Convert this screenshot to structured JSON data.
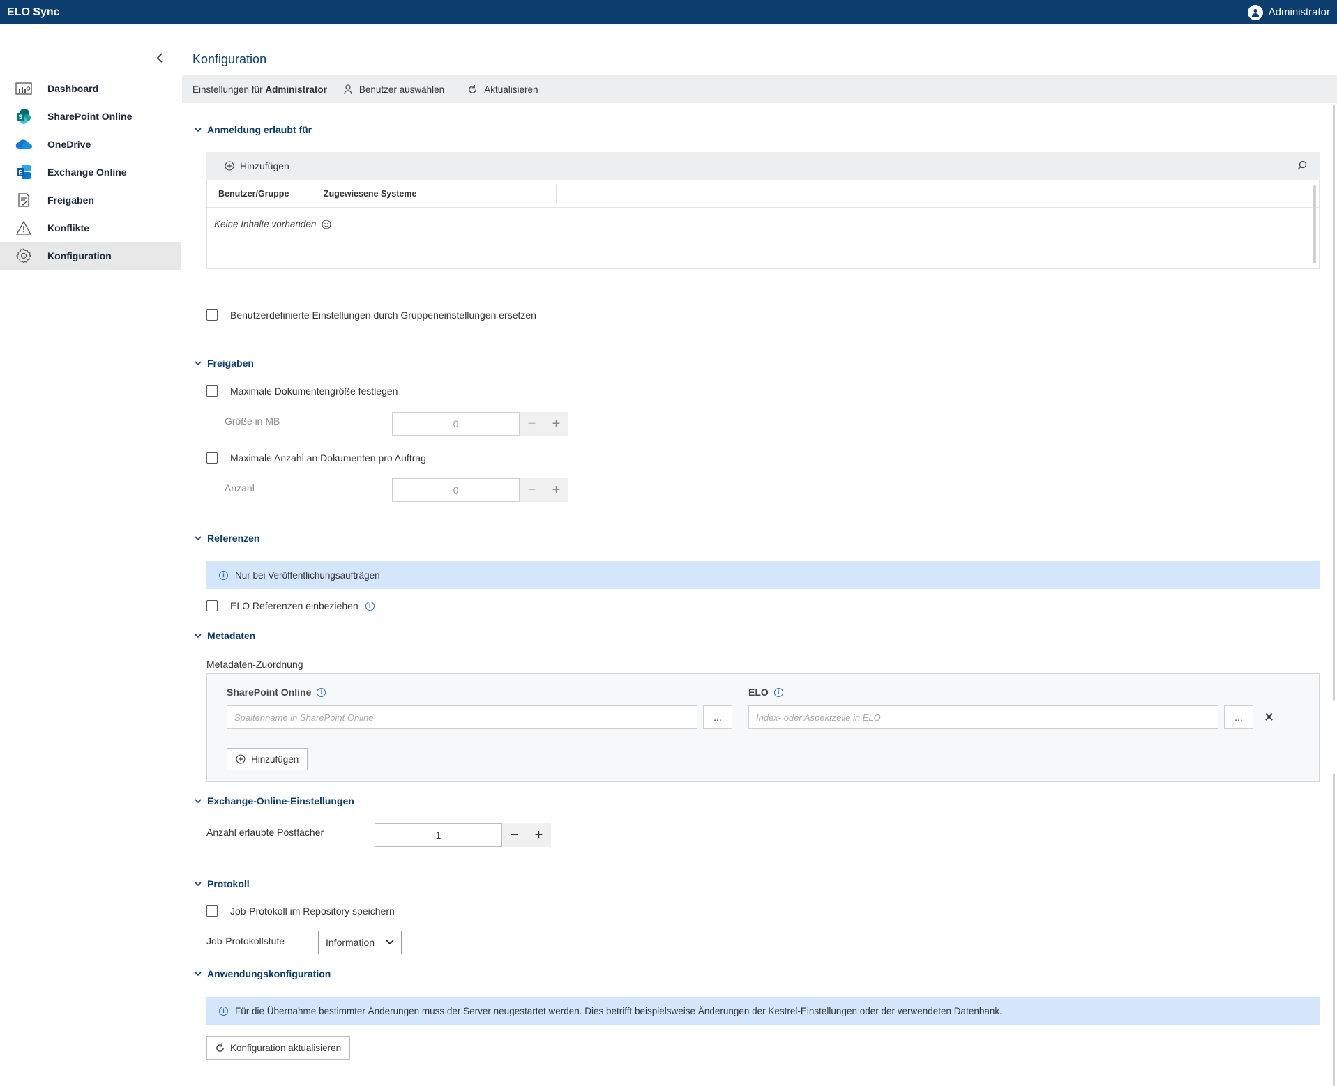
{
  "app": {
    "title": "ELO Sync",
    "user": "Administrator"
  },
  "sidebar": {
    "items": [
      {
        "label": "Dashboard",
        "icon": "dashboard-icon"
      },
      {
        "label": "SharePoint Online",
        "icon": "sharepoint-icon"
      },
      {
        "label": "OneDrive",
        "icon": "onedrive-icon"
      },
      {
        "label": "Exchange Online",
        "icon": "exchange-icon"
      },
      {
        "label": "Freigaben",
        "icon": "approval-icon"
      },
      {
        "label": "Konflikte",
        "icon": "warning-icon"
      },
      {
        "label": "Konfiguration",
        "icon": "gear-icon",
        "active": true
      }
    ]
  },
  "page": {
    "title": "Konfiguration"
  },
  "toolbar": {
    "settings_prefix": "Einstellungen für",
    "settings_user": "Administrator",
    "select_user": "Benutzer auswählen",
    "refresh": "Aktualisieren"
  },
  "login": {
    "heading": "Anmeldung erlaubt für",
    "add": "Hinzufügen",
    "columns": [
      "Benutzer/Gruppe",
      "Zugewiesene Systeme"
    ],
    "empty": "Keine Inhalte vorhanden",
    "replace_checkbox": "Benutzerdefinierte Einstellungen durch Gruppeneinstellungen ersetzen"
  },
  "freigaben": {
    "heading": "Freigaben",
    "max_size_checkbox": "Maximale Dokumentengröße festlegen",
    "size_label": "Größe in MB",
    "size_value": "0",
    "max_count_checkbox": "Maximale Anzahl an Dokumenten pro Auftrag",
    "count_label": "Anzahl",
    "count_value": "0"
  },
  "referenzen": {
    "heading": "Referenzen",
    "info": "Nur bei Veröffentlichungsaufträgen",
    "include_checkbox": "ELO Referenzen einbeziehen"
  },
  "metadaten": {
    "heading": "Metadaten",
    "mapping_label": "Metadaten-Zuordnung",
    "sp_header": "SharePoint Online",
    "elo_header": "ELO",
    "sp_placeholder": "Spaltenname in SharePoint Online",
    "elo_placeholder": "Index- oder Aspektzeile in ELO",
    "dots": "...",
    "add": "Hinzufügen"
  },
  "exchange": {
    "heading": "Exchange-Online-Einstellungen",
    "mailboxes_label": "Anzahl erlaubte Postfächer",
    "mailboxes_value": "1"
  },
  "protokoll": {
    "heading": "Protokoll",
    "save_checkbox": "Job-Protokoll im Repository speichern",
    "level_label": "Job-Protokollstufe",
    "level_value": "Information"
  },
  "anwendung": {
    "heading": "Anwendungskonfiguration",
    "info": "Für die Übernahme bestimmter Änderungen muss der Server neugestartet werden. Dies betrifft beispielsweise Änderungen der Kestrel-Einstellungen oder der verwendeten Datenbank.",
    "update_button": "Konfiguration aktualisieren"
  },
  "colors": {
    "topbar": "#0b3d6e",
    "accent": "#0b3d6e",
    "info_bg": "#d4e6fb"
  }
}
